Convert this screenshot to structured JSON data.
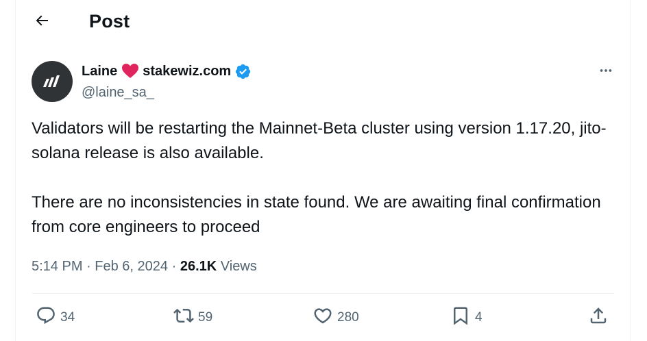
{
  "header": {
    "title": "Post"
  },
  "author": {
    "name_first": "Laine",
    "name_second": "stakewiz.com",
    "handle": "@laine_sa_"
  },
  "post": {
    "paragraphs": [
      "Validators will be restarting the Mainnet-Beta cluster using version 1.17.20, jito-solana release is also available.",
      "There are no inconsistencies in state found. We are awaiting final confirmation from core engineers to proceed"
    ],
    "time": "5:14 PM",
    "separator": "·",
    "date": "Feb 6, 2024",
    "views_count": "26.1K",
    "views_label": "Views"
  },
  "actions": {
    "replies": "34",
    "reposts": "59",
    "likes": "280",
    "bookmarks": "4"
  },
  "icons": {
    "back": "arrow-left-icon",
    "heart_emoji": "red-heart-icon",
    "verified": "verified-badge-icon",
    "more": "more-horizontal-icon",
    "reply": "reply-icon",
    "repost": "repost-icon",
    "like": "heart-icon",
    "bookmark": "bookmark-icon",
    "share": "share-icon"
  },
  "colors": {
    "text": "#0f1419",
    "secondary": "#536471",
    "verified": "#1d9bf0",
    "heart_emoji": "#e0245e",
    "avatar_bg": "#2f3336"
  }
}
